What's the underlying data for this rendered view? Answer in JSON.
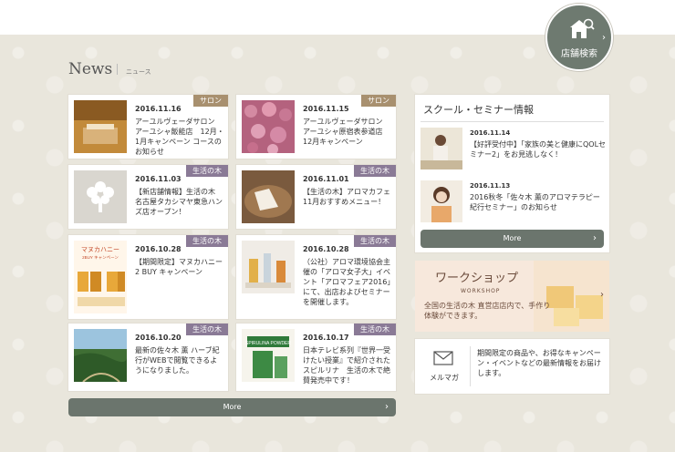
{
  "store_search": {
    "label": "店舗検索",
    "arrow": "›"
  },
  "news": {
    "title": "News",
    "subtitle": "ニュース"
  },
  "news_items": [
    {
      "badge": "サロン",
      "date": "2016.11.16",
      "text": "アーユルヴェーダサロン　アーユシャ飯能店　12月・1月キャンペーン コースのお知らせ"
    },
    {
      "badge": "サロン",
      "date": "2016.11.15",
      "text": "アーユルヴェーダサロン アーユシャ原宿表参道店　12月キャンペーン"
    },
    {
      "badge": "生活の木",
      "date": "2016.11.03",
      "text": "【新店舗情報】生活の木　名古屋タカシマヤ東急ハンズ店オープン！"
    },
    {
      "badge": "生活の木",
      "date": "2016.11.01",
      "text": "【生活の木】アロマカフェ11月おすすめメニュー！"
    },
    {
      "badge": "生活の木",
      "date": "2016.10.28",
      "text": "【期間限定】マヌカハニー　2 BUY キャンペーン"
    },
    {
      "badge": "生活の木",
      "date": "2016.10.28",
      "text": "（公社）アロマ環境協会主催の「アロマ女子大」イベント「アロマフェア2016」にて、出店およびセミナーを開催します。"
    },
    {
      "badge": "生活の木",
      "date": "2016.10.20",
      "text": "最新の佐々木 薫 ハーブ紀行がWEBで閲覧できるようになりました。"
    },
    {
      "badge": "生活の木",
      "date": "2016.10.17",
      "text": "日本テレビ系列『世界一受けたい授業』で紹介されたスピルリナ　生活の木で絶賛発売中です！"
    }
  ],
  "news_more": "More",
  "school": {
    "title": "スクール・セミナー情報",
    "items": [
      {
        "date": "2016.11.14",
        "text": "【好評受付中】「家族の美と健康にQOLセミナー2」をお見逃しなく！"
      },
      {
        "date": "2016.11.13",
        "text": "2016秋冬「佐々木 薫のアロマテラピー紀行セミナー」のお知らせ"
      }
    ],
    "more": "More"
  },
  "workshop": {
    "title": "ワークショップ",
    "en": "WORKSHOP",
    "text": "全国の生活の木 直営店店内で、手作り体験ができます。",
    "arrow": "›"
  },
  "mailmag": {
    "label": "メルマガ",
    "text": "期間限定の商品や、お得なキャンペーン・イベントなどの最新情報をお届けします。"
  },
  "thumb_labels": {
    "manuka": "マヌカハニー",
    "manuka_sub": "2BUY キャンペーン",
    "spirulina": "SPIRULINA POWDER"
  },
  "colors": {
    "badge_salon": "#a8906f",
    "badge_tree": "#8a7a96",
    "button": "#6b756d",
    "background": "#e9e6dc"
  }
}
